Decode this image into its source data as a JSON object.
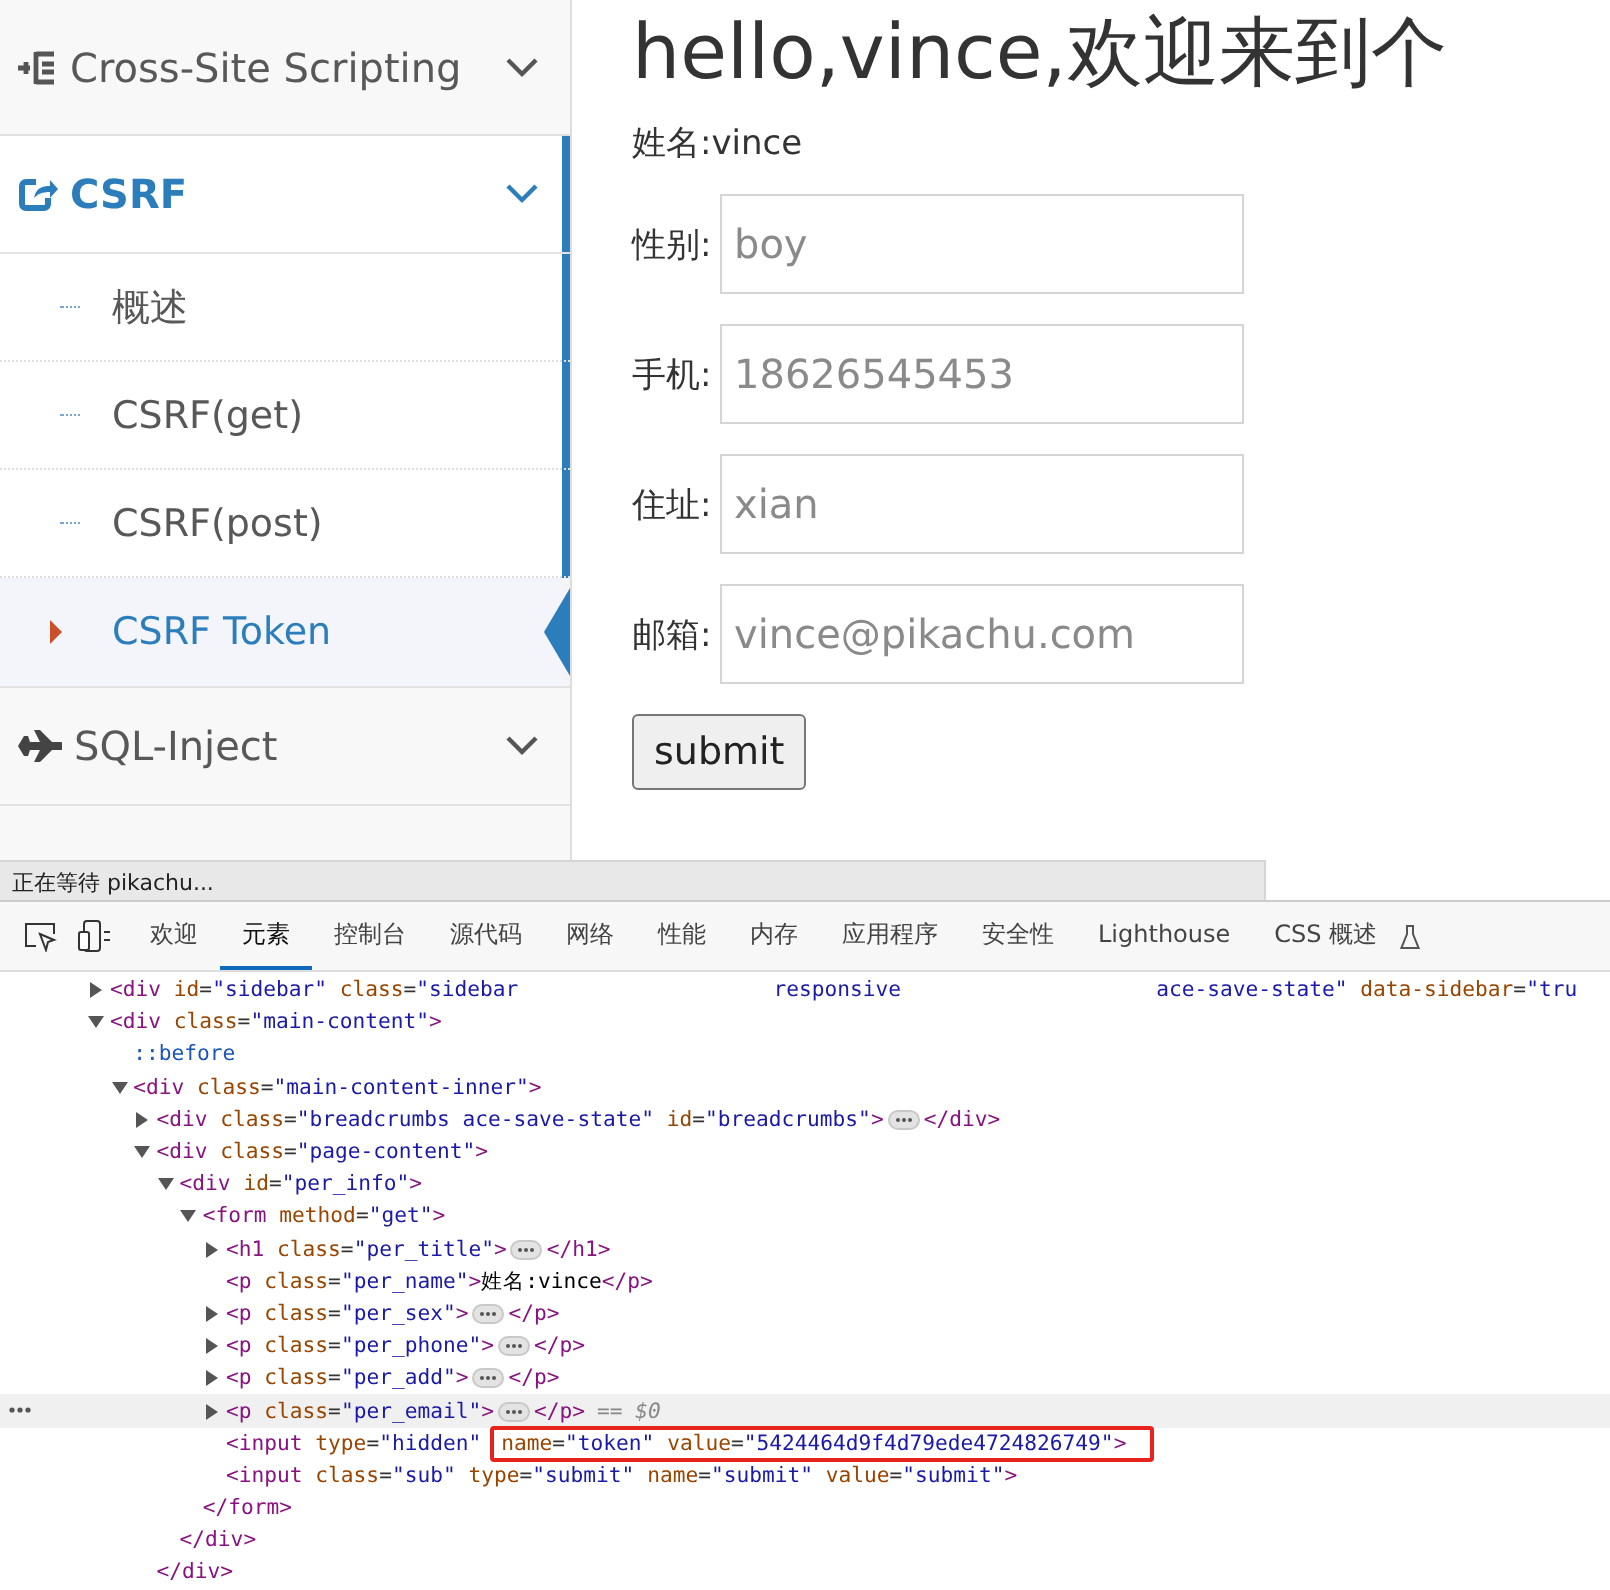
{
  "sidebar": {
    "items": [
      {
        "label": "Cross-Site Scripting",
        "selected": false
      },
      {
        "label": "CSRF",
        "expanded": true,
        "selected": true,
        "children": [
          {
            "label": "概述",
            "selected": false
          },
          {
            "label": "CSRF(get)",
            "selected": false
          },
          {
            "label": "CSRF(post)",
            "selected": false
          },
          {
            "label": "CSRF Token",
            "selected": true
          }
        ]
      },
      {
        "label": "SQL-Inject",
        "selected": false
      }
    ]
  },
  "page": {
    "title": "hello,vince,欢迎来到个",
    "name_line": "姓名:vince",
    "fields": [
      {
        "label": "性别:",
        "placeholder": "boy"
      },
      {
        "label": "手机:",
        "placeholder": "18626545453"
      },
      {
        "label": "住址:",
        "placeholder": "xian"
      },
      {
        "label": "邮箱:",
        "placeholder": "vince@pikachu.com"
      }
    ],
    "submit": "submit"
  },
  "status_bubble": "正在等待 pikachu...",
  "devtools": {
    "tabs": [
      {
        "label": "欢迎",
        "selected": false
      },
      {
        "label": "元素",
        "selected": true
      },
      {
        "label": "控制台",
        "selected": false
      },
      {
        "label": "源代码",
        "selected": false
      },
      {
        "label": "网络",
        "selected": false
      },
      {
        "label": "性能",
        "selected": false
      },
      {
        "label": "内存",
        "selected": false
      },
      {
        "label": "应用程序",
        "selected": false
      },
      {
        "label": "安全性",
        "selected": false
      },
      {
        "label": "Lighthouse",
        "selected": false
      },
      {
        "label": "CSS 概述",
        "selected": false
      }
    ],
    "tree": [
      {
        "open": "<div id=\"sidebar\" class=\"sidebar                    responsive                    ace-save-state\" data-sidebar=\"tru",
        "expanded": false,
        "selected": false
      },
      {
        "open": "<div class=\"main-content\">",
        "expanded": true,
        "selected": false,
        "children": [
          {
            "open": "::before",
            "kind": "pseudo",
            "selected": false
          },
          {
            "open": "<div class=\"main-content-inner\">",
            "expanded": true,
            "selected": false,
            "children": [
              {
                "open": "<div class=\"breadcrumbs ace-save-state\" id=\"breadcrumbs\">",
                "expanded": false,
                "close": "</div>",
                "selected": false
              },
              {
                "open": "<div class=\"page-content\">",
                "expanded": true,
                "selected": false,
                "close": "</div>",
                "children": [
                  {
                    "open": "<div id=\"per_info\">",
                    "expanded": true,
                    "selected": false,
                    "close": "</div>",
                    "children": [
                      {
                        "open": "<form method=\"get\">",
                        "expanded": true,
                        "selected": false,
                        "close": "</form>",
                        "children": [
                          {
                            "open": "<h1 class=\"per_title\">",
                            "expanded": false,
                            "close": "</h1>",
                            "selected": false
                          },
                          {
                            "open": "<p class=\"per_name\">姓名:vince</p>",
                            "selected": false
                          },
                          {
                            "open": "<p class=\"per_sex\">",
                            "expanded": false,
                            "close": "</p>",
                            "selected": false
                          },
                          {
                            "open": "<p class=\"per_phone\">",
                            "expanded": false,
                            "close": "</p>",
                            "selected": false
                          },
                          {
                            "open": "<p class=\"per_add\">",
                            "expanded": false,
                            "close": "</p>",
                            "selected": false
                          },
                          {
                            "open": "<p class=\"per_email\">",
                            "expanded": false,
                            "close": "</p>",
                            "selected": true,
                            "note": "== $0"
                          },
                          {
                            "open": "<input type=\"hidden\"",
                            "boxed": "name=\"token\" value=\"5424464d9f4d79ede4724826749\">",
                            "selected": false
                          },
                          {
                            "open": "<input class=\"sub\" type=\"submit\" name=\"submit\" value=\"submit\">",
                            "selected": false
                          }
                        ]
                      }
                    ]
                  }
                ]
              }
            ]
          }
        ]
      }
    ]
  }
}
